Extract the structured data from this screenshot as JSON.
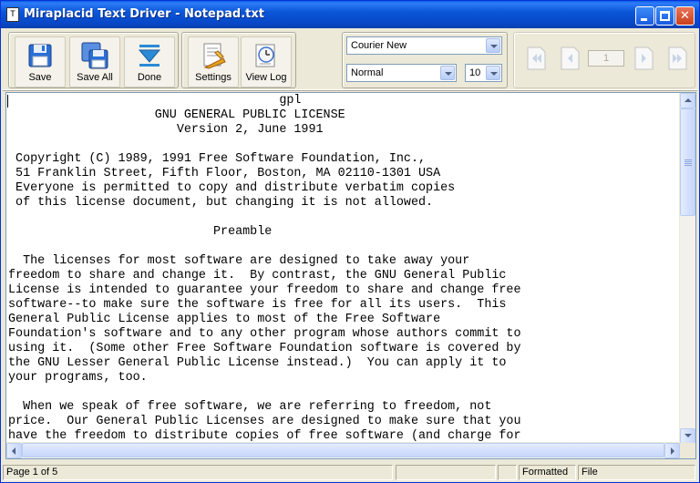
{
  "window": {
    "title": "Miraplacid Text Driver - Notepad.txt",
    "app_icon_glyph": "T"
  },
  "toolbar": {
    "buttons": [
      {
        "label": "Save",
        "icon": "floppy-disk-icon"
      },
      {
        "label": "Save All",
        "icon": "floppy-disks-icon"
      },
      {
        "label": "Done",
        "icon": "down-arrow-icon"
      },
      {
        "label": "Settings",
        "icon": "settings-document-icon"
      },
      {
        "label": "View Log",
        "icon": "log-clock-icon"
      }
    ],
    "font_name": "Courier New",
    "font_style": "Normal",
    "font_size": "10",
    "page_number": "1"
  },
  "document": {
    "lines": [
      "                                     gpl",
      "                    GNU GENERAL PUBLIC LICENSE",
      "                       Version 2, June 1991",
      "",
      " Copyright (C) 1989, 1991 Free Software Foundation, Inc.,",
      " 51 Franklin Street, Fifth Floor, Boston, MA 02110-1301 USA",
      " Everyone is permitted to copy and distribute verbatim copies",
      " of this license document, but changing it is not allowed.",
      "",
      "                            Preamble",
      "",
      "  The licenses for most software are designed to take away your",
      "freedom to share and change it.  By contrast, the GNU General Public",
      "License is intended to guarantee your freedom to share and change free",
      "software--to make sure the software is free for all its users.  This",
      "General Public License applies to most of the Free Software",
      "Foundation's software and to any other program whose authors commit to",
      "using it.  (Some other Free Software Foundation software is covered by",
      "the GNU Lesser General Public License instead.)  You can apply it to",
      "your programs, too.",
      "",
      "  When we speak of free software, we are referring to freedom, not",
      "price.  Our General Public Licenses are designed to make sure that you",
      "have the freedom to distribute copies of free software (and charge for"
    ]
  },
  "status": {
    "page": "Page 1 of 5",
    "mode": "Formatted",
    "source": "File"
  },
  "colors": {
    "titlebar": "#0a56d8",
    "chrome": "#ece9d8",
    "icon_blue": "#2a6fd6",
    "icon_orange": "#e8a020"
  }
}
